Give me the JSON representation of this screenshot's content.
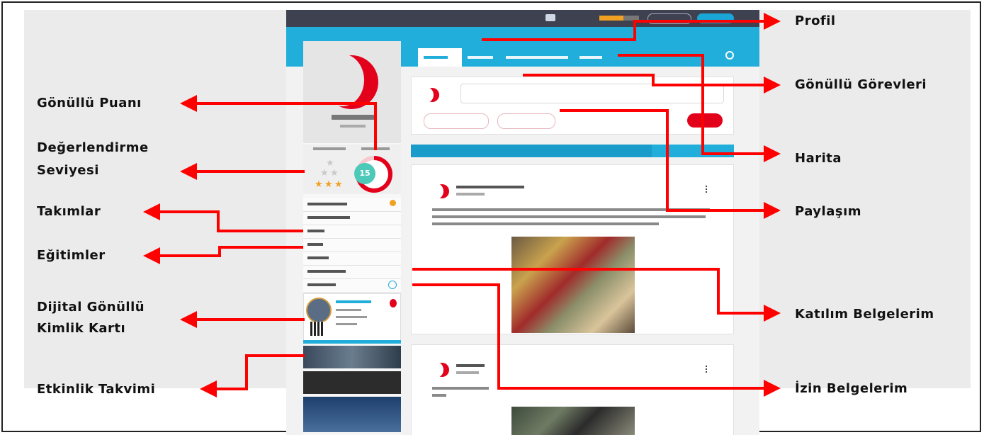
{
  "labels": {
    "profil": "Profil",
    "gonullu_gorevleri": "Gönüllü Görevleri",
    "harita": "Harita",
    "paylasim": "Paylaşım",
    "katilim_belgelerim": "Katılım Belgelerim",
    "izin_belgelerim": "İzin Belgelerim",
    "gonullu_puani": "Gönüllü Puanı",
    "degerlendirme_line1": "Değerlendirme",
    "degerlendirme_line2": "Seviyesi",
    "takimlar": "Takımlar",
    "egitimler": "Eğitimler",
    "dijital_line1": "Dijital Gönüllü",
    "dijital_line2": "Kimlik Kartı",
    "etkinlik_takvimi": "Etkinlik Takvimi"
  },
  "app": {
    "score": "15",
    "progress": 0.6
  },
  "colors": {
    "arrow": "#ff0000",
    "accent": "#22aedb",
    "brand_red": "#e3001b",
    "topbar": "#3d4150",
    "panel": "#ebebeb"
  }
}
